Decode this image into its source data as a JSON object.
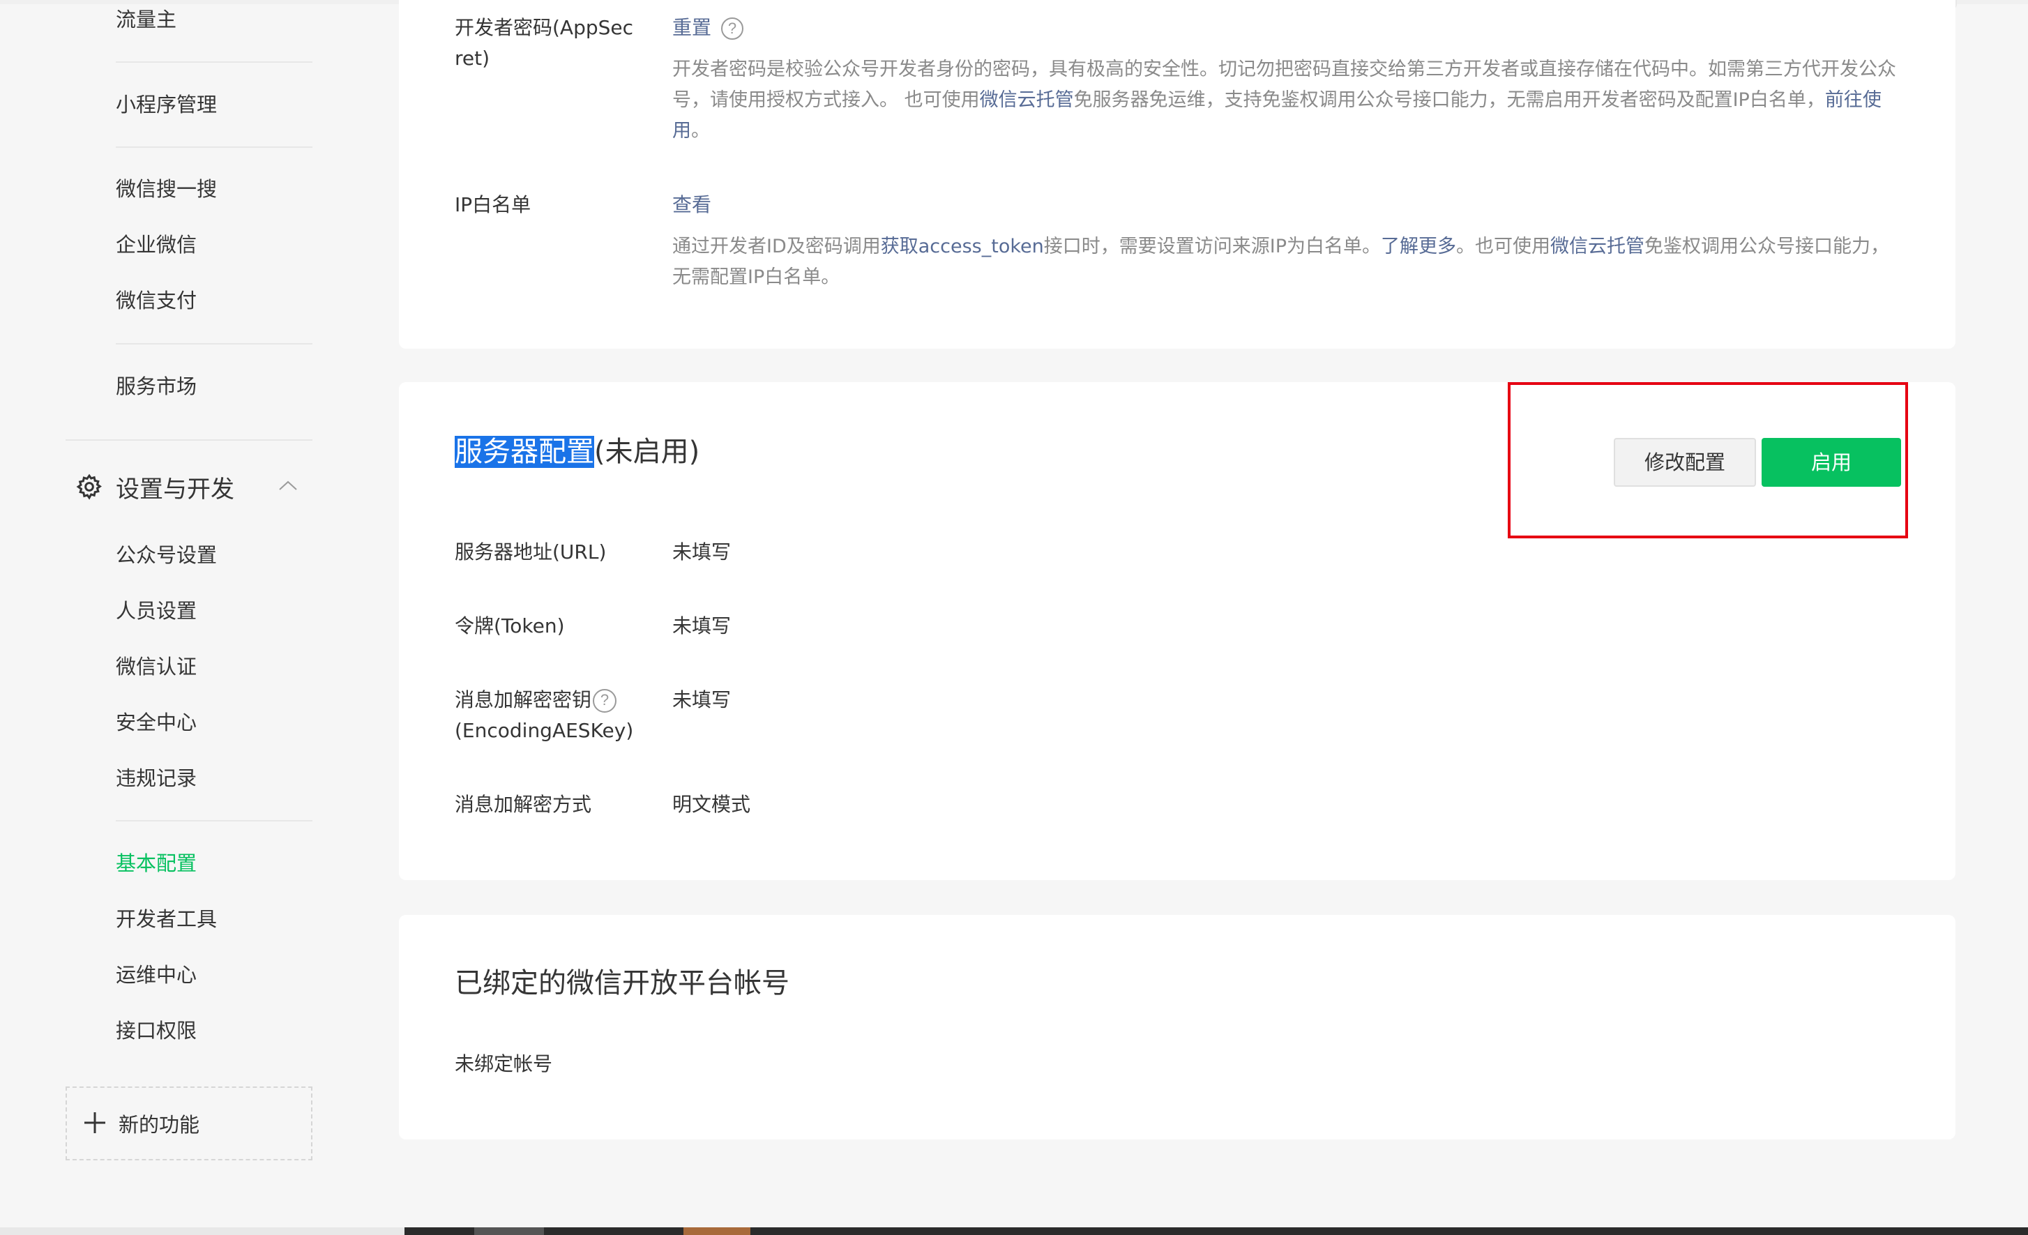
{
  "sidebar": {
    "items_top": [
      {
        "label": "流量主"
      },
      {
        "label": "小程序管理"
      },
      {
        "label": "微信搜一搜"
      },
      {
        "label": "企业微信"
      },
      {
        "label": "微信支付"
      },
      {
        "label": "服务市场"
      }
    ],
    "section": {
      "title": "设置与开发",
      "icon": "gear-icon",
      "expanded": true
    },
    "items_settings": [
      {
        "label": "公众号设置"
      },
      {
        "label": "人员设置"
      },
      {
        "label": "微信认证"
      },
      {
        "label": "安全中心"
      },
      {
        "label": "违规记录"
      }
    ],
    "items_dev": [
      {
        "label": "基本配置",
        "active": true
      },
      {
        "label": "开发者工具"
      },
      {
        "label": "运维中心"
      },
      {
        "label": "接口权限"
      }
    ],
    "new_feature": {
      "label": "新的功能",
      "icon": "plus-icon"
    }
  },
  "developer": {
    "secret": {
      "label": "开发者密码(AppSec ret)",
      "action": "重置",
      "desc_part1": "开发者密码是校验公众号开发者身份的密码，具有极高的安全性。切记勿把密码直接交给第三方开发者或直接存储在代码中。如需第三方代开发公众号，请使用授权方式接入。 也可使用",
      "desc_link1": "微信云托管",
      "desc_part2": "免服务器免运维，支持免鉴权调用公众号接口能力，无需启用开发者密码及配置IP白名单，",
      "desc_link2": "前往使用",
      "desc_part3": "。"
    },
    "ip_whitelist": {
      "label": "IP白名单",
      "action": "查看",
      "desc_part1": "通过开发者ID及密码调用",
      "desc_link1": "获取access_token",
      "desc_part2": "接口时，需要设置访问来源IP为白名单。",
      "desc_link2": "了解更多",
      "desc_part3": "。也可使用",
      "desc_link3": "微信云托管",
      "desc_part4": "免鉴权调用公众号接口能力，无需配置IP白名单。"
    }
  },
  "server_config": {
    "title_highlight": "服务器配置",
    "title_status": "(未启用)",
    "modify_button": "修改配置",
    "enable_button": "启用",
    "fields": [
      {
        "label": "服务器地址(URL)",
        "value": "未填写"
      },
      {
        "label": "令牌(Token)",
        "value": "未填写"
      },
      {
        "label_line1": "消息加解密密钥",
        "label_line2": "(EncodingAESKey)",
        "value": "未填写"
      },
      {
        "label": "消息加解密方式",
        "value": "明文模式"
      }
    ]
  },
  "open_platform": {
    "title": "已绑定的微信开放平台帐号",
    "status": "未绑定帐号"
  },
  "colors": {
    "accent_green": "#07c160",
    "link_blue": "#576b95",
    "highlight_blue": "#1a73e8",
    "annotation_red": "#e60012"
  }
}
